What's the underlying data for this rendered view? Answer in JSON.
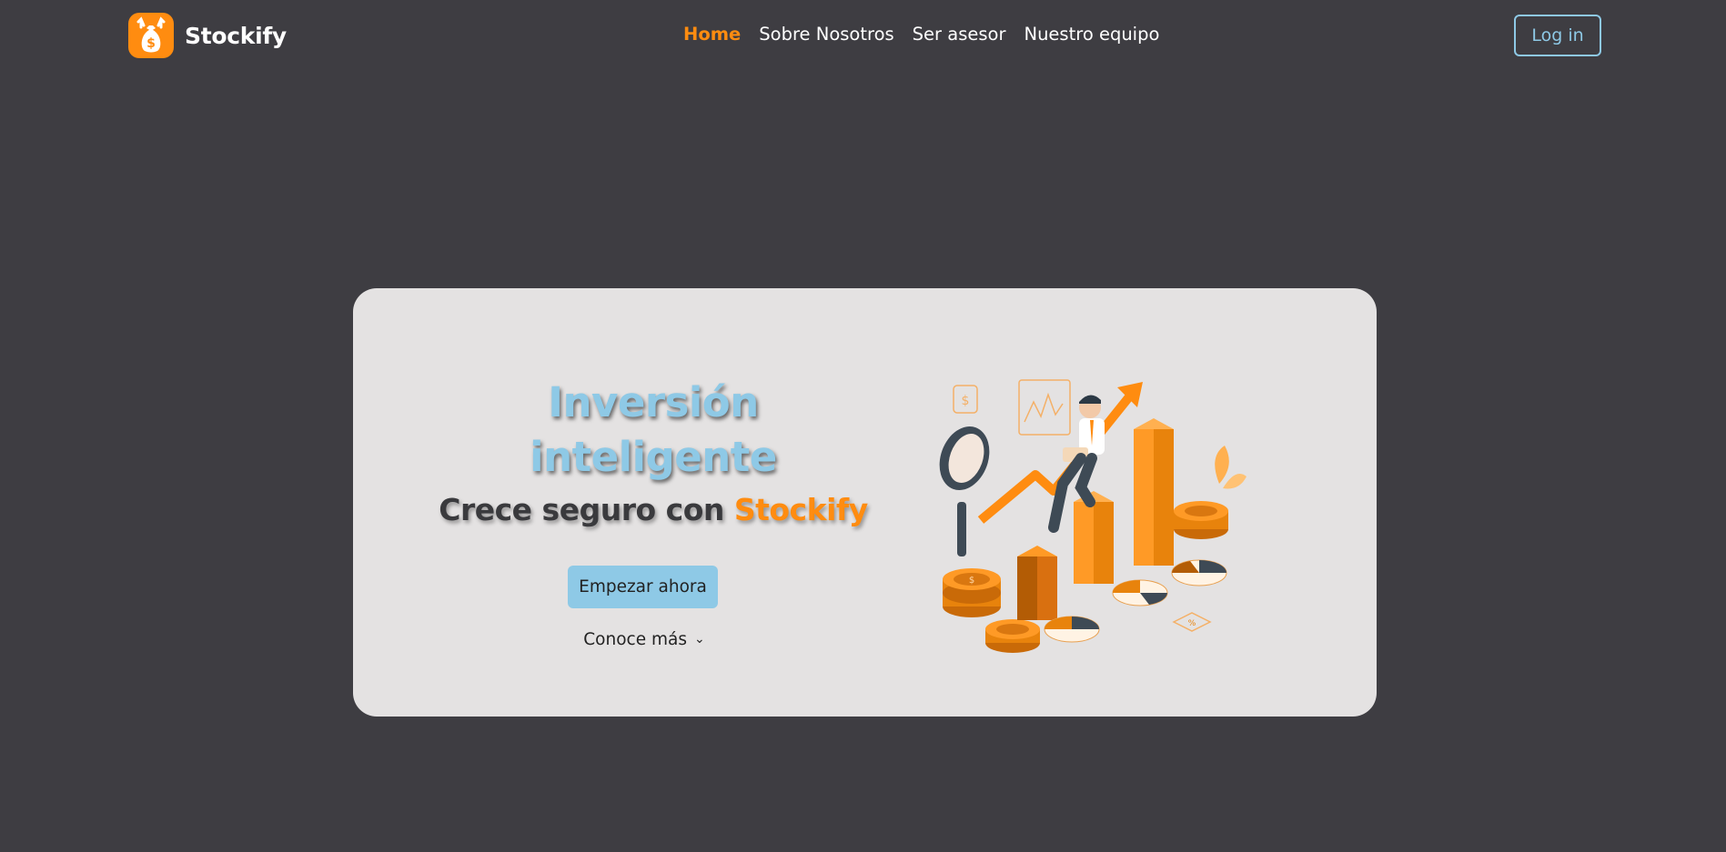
{
  "nav": {
    "brand": "Stockify",
    "links": [
      {
        "label": "Home",
        "active": true
      },
      {
        "label": "Sobre Nosotros",
        "active": false
      },
      {
        "label": "Ser asesor",
        "active": false
      },
      {
        "label": "Nuestro equipo",
        "active": false
      }
    ],
    "login_label": "Log in"
  },
  "hero": {
    "headline_line1": "Inversión",
    "headline_line2": "inteligente",
    "subline_prefix": "Crece seguro con ",
    "subline_brand": "Stockify",
    "cta_label": "Empezar ahora",
    "more_label": "Conoce más",
    "illustration_name": "investor-growth-illustration"
  },
  "colors": {
    "background": "#3e3d42",
    "accent_orange": "#ff8c10",
    "accent_blue": "#8ec9e6",
    "card": "#e4e2e2"
  },
  "icons": {
    "logo": "money-bag-icon",
    "more_chevron": "chevron-down-icon"
  }
}
